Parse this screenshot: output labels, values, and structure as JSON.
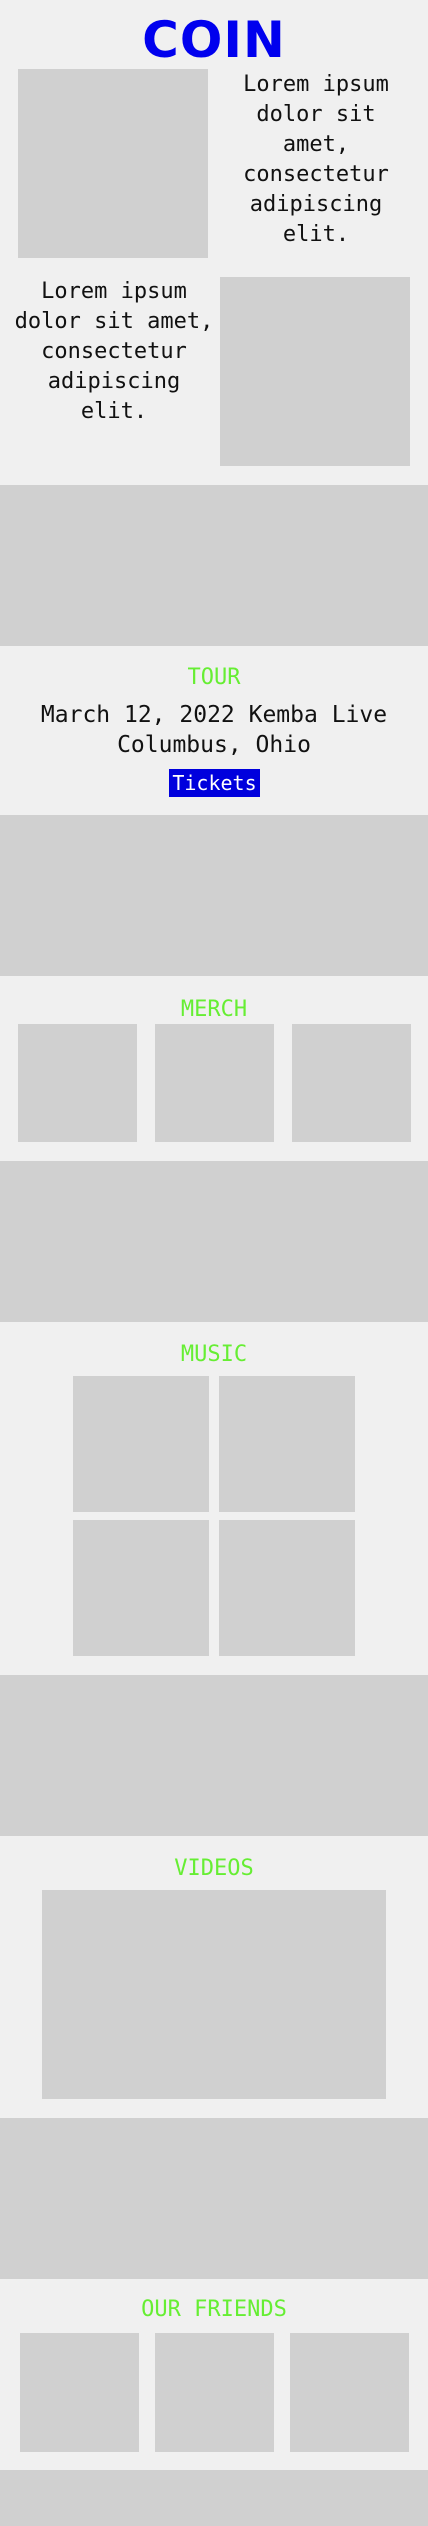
{
  "header": {
    "logo": "COIN"
  },
  "intro": {
    "block1_text": "Lorem ipsum dolor sit amet, consectetur adipiscing elit.",
    "block2_text": "Lorem ipsum dolor sit amet, consectetur adipiscing elit."
  },
  "tour": {
    "title": "TOUR",
    "event_line1": "March 12, 2022 Kemba Live",
    "event_line2": "Columbus, Ohio",
    "tickets_label": "Tickets"
  },
  "merch": {
    "title": "MERCH"
  },
  "music": {
    "title": "MUSIC"
  },
  "videos": {
    "title": "VIDEOS"
  },
  "friends": {
    "title": "OUR FRIENDS"
  },
  "colors": {
    "brand": "#0000ee",
    "section_title": "#66ee33",
    "button_bg": "#0000dd",
    "placeholder": "#d0d0d0",
    "background": "#f0f0f0"
  }
}
